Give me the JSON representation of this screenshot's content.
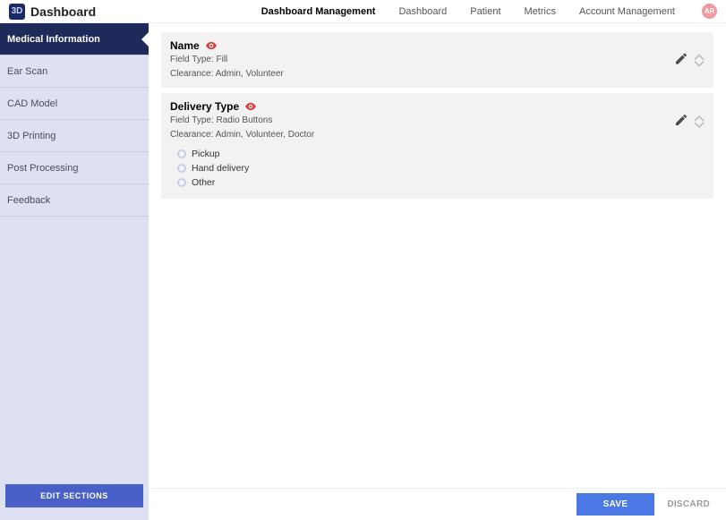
{
  "header": {
    "title": "Dashboard",
    "avatar_initials": "AR",
    "nav": [
      {
        "label": "Dashboard Management",
        "active": true
      },
      {
        "label": "Dashboard",
        "active": false
      },
      {
        "label": "Patient",
        "active": false
      },
      {
        "label": "Metrics",
        "active": false
      },
      {
        "label": "Account Management",
        "active": false
      }
    ]
  },
  "sidebar": {
    "items": [
      {
        "label": "Medical Information",
        "active": true
      },
      {
        "label": "Ear Scan",
        "active": false
      },
      {
        "label": "CAD Model",
        "active": false
      },
      {
        "label": "3D Printing",
        "active": false
      },
      {
        "label": "Post Processing",
        "active": false
      },
      {
        "label": "Feedback",
        "active": false
      }
    ],
    "edit_button": "EDIT SECTIONS"
  },
  "fields": [
    {
      "name": "Name",
      "field_type_label": "Field Type: Fill",
      "clearance_label": "Clearance: Admin, Volunteer",
      "visibility_icon": "eye",
      "options": []
    },
    {
      "name": "Delivery Type",
      "field_type_label": "Field Type: Radio Buttons",
      "clearance_label": "Clearance: Admin, Volunteer, Doctor",
      "visibility_icon": "eye",
      "options": [
        "Pickup",
        "Hand delivery",
        "Other"
      ]
    }
  ],
  "footer": {
    "save": "SAVE",
    "discard": "DISCARD"
  }
}
